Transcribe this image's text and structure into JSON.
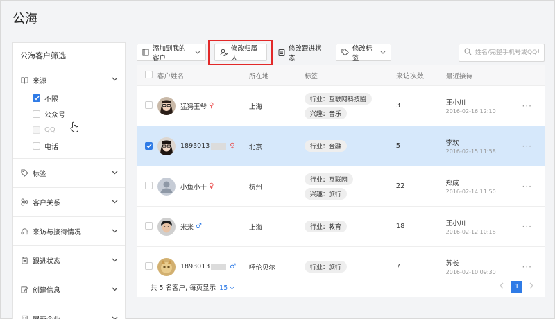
{
  "page_title": "公海",
  "sidebar": {
    "title": "公海客户筛选",
    "groups": [
      {
        "label": "来源",
        "icon": "book-icon",
        "open": true,
        "options": [
          {
            "label": "不限",
            "checked": true,
            "disabled": false
          },
          {
            "label": "公众号",
            "checked": false,
            "disabled": false
          },
          {
            "label": "QQ",
            "checked": false,
            "disabled": true
          },
          {
            "label": "电话",
            "checked": false,
            "disabled": false
          }
        ]
      },
      {
        "label": "标签",
        "icon": "tag-icon"
      },
      {
        "label": "客户关系",
        "icon": "relation-icon"
      },
      {
        "label": "来访与接待情况",
        "icon": "headset-icon"
      },
      {
        "label": "跟进状态",
        "icon": "clipboard-icon"
      },
      {
        "label": "创建信息",
        "icon": "edit-icon"
      },
      {
        "label": "屏蔽企业",
        "icon": "building-icon"
      }
    ]
  },
  "toolbar": {
    "add_label": "添加到我的客户",
    "owner_label": "修改归属人",
    "status_label": "修改跟进状态",
    "tag_label": "修改标签",
    "search_placeholder": "姓名/完整手机号或QQ号"
  },
  "table": {
    "headers": {
      "name": "客户姓名",
      "location": "所在地",
      "tags": "标签",
      "visits": "来访次数",
      "recent": "最近接待"
    },
    "rows": [
      {
        "name": "猛犸王爷",
        "masked": false,
        "gender": "♀",
        "location": "上海",
        "tags": [
          "行业：互联网科技圈",
          "兴趣：音乐"
        ],
        "visits": "3",
        "recent_name": "王小川",
        "recent_time": "2016-02-16  12:10",
        "selected": false,
        "avatar": "woman-glasses"
      },
      {
        "name": "1893013",
        "masked": true,
        "gender": "♀",
        "location": "北京",
        "tags": [
          "行业：金融"
        ],
        "visits": "5",
        "recent_name": "李欢",
        "recent_time": "2016-02-15  11:58",
        "selected": true,
        "avatar": "woman-glasses"
      },
      {
        "name": "小鱼小干",
        "masked": false,
        "gender": "♀",
        "location": "杭州",
        "tags": [
          "行业：互联网",
          "兴趣：旅行"
        ],
        "visits": "22",
        "recent_name": "郑成",
        "recent_time": "2016-02-14  11:50",
        "selected": false,
        "avatar": "placeholder"
      },
      {
        "name": "米米",
        "masked": false,
        "gender": "♂",
        "location": "上海",
        "tags": [
          "行业：教育"
        ],
        "visits": "18",
        "recent_name": "王小川",
        "recent_time": "2016-02-12  10:18",
        "selected": false,
        "avatar": "man"
      },
      {
        "name": "1893013",
        "masked": true,
        "gender": "♂",
        "location": "呼伦贝尔",
        "tags": [
          "行业：旅行"
        ],
        "visits": "7",
        "recent_name": "苏长",
        "recent_time": "2016-02-10  09:30",
        "selected": false,
        "avatar": "cat"
      }
    ]
  },
  "pager": {
    "summary": "共 5 名客户, 每页显示",
    "page_size": "15",
    "current_page": "1"
  },
  "colors": {
    "accent": "#2f7be6",
    "selected_row": "#d6e8fb",
    "female": "#e94b4b",
    "male": "#2f7be6",
    "highlight": "#e22929"
  }
}
